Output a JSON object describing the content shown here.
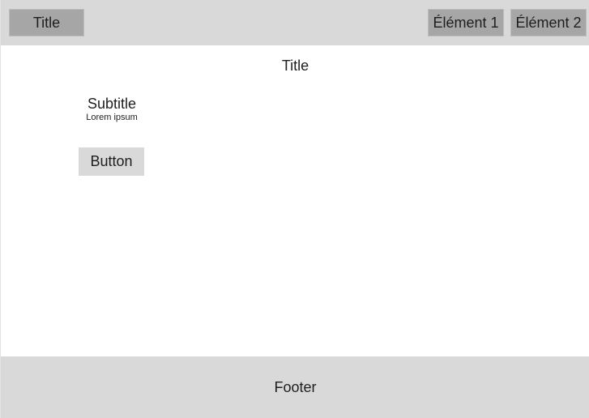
{
  "header": {
    "title": "Title",
    "nav_items": [
      {
        "label": "Élément 1"
      },
      {
        "label": "Élément 2"
      }
    ]
  },
  "main": {
    "title": "Title",
    "card": {
      "subtitle": "Subtitle",
      "body": "Lorem ipsum",
      "button_label": "Button"
    }
  },
  "footer": {
    "label": "Footer"
  },
  "colors": {
    "header_bg": "#d9d9d9",
    "nav_item_bg": "#a6a6a6",
    "button_bg": "#d9d9d9",
    "footer_bg": "#d9d9d9",
    "page_bg": "#ffffff",
    "text": "#1e1e1e"
  }
}
